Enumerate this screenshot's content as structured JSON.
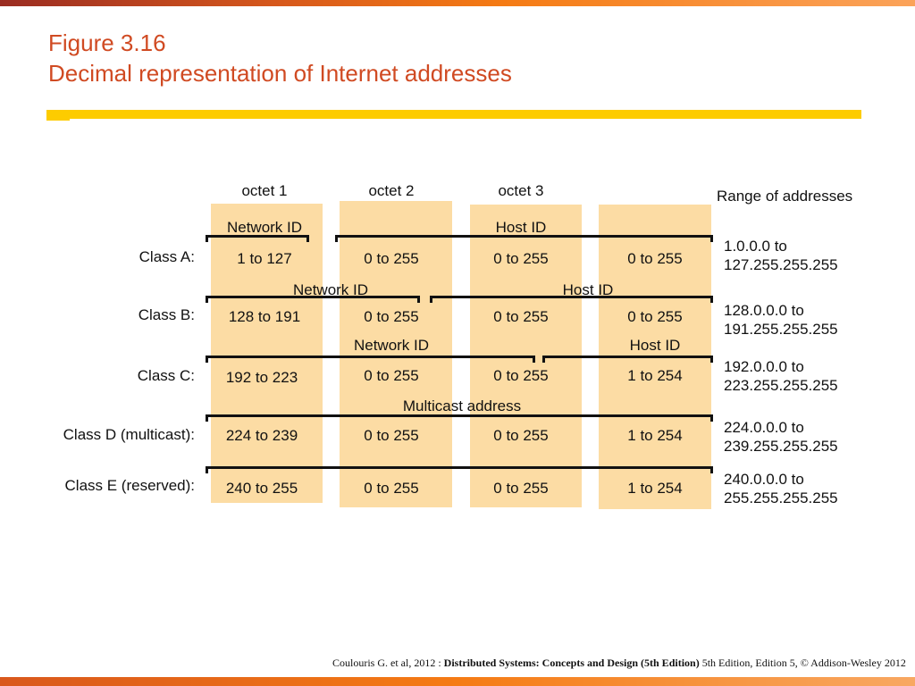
{
  "header": {
    "title_line1": "Figure 3.16",
    "title_line2": "Decimal representation of Internet addresses"
  },
  "columns": {
    "octet1": "octet 1",
    "octet2": "octet 2",
    "octet3": "octet 3",
    "range": "Range of addresses"
  },
  "rows": [
    {
      "label": "Class A:",
      "cells": [
        "1 to 127",
        "0 to 255",
        "0 to 255",
        "0 to 255"
      ],
      "range1": "1.0.0.0 to",
      "range2": "127.255.255.255",
      "net": "Network ID",
      "host": "Host ID"
    },
    {
      "label": "Class B:",
      "cells": [
        "128 to 191",
        "0 to 255",
        "0 to 255",
        "0 to 255"
      ],
      "range1": "128.0.0.0 to",
      "range2": "191.255.255.255",
      "net": "Network ID",
      "host": "Host ID"
    },
    {
      "label": "Class C:",
      "cells": [
        "192 to 223",
        "0 to 255",
        "0 to 255",
        "1 to 254"
      ],
      "range1": "192.0.0.0 to",
      "range2": "223.255.255.255",
      "net": "Network ID",
      "host": "Host ID"
    },
    {
      "label": "Class D (multicast):",
      "cells": [
        "224 to 239",
        "0 to 255",
        "0 to 255",
        "1 to 254"
      ],
      "range1": "224.0.0.0 to",
      "range2": "239.255.255.255",
      "net": "Multicast address"
    },
    {
      "label": "Class E (reserved):",
      "cells": [
        "240 to 255",
        "0 to 255",
        "0 to 255",
        "1 to 254"
      ],
      "range1": "240.0.0.0 to",
      "range2": "255.255.255.255"
    }
  ],
  "footer": {
    "pre": "Coulouris G. et al, 2012 : ",
    "bold": "Distributed Systems: Concepts and Design (5th Edition)",
    "post": " 5th Edition, Edition 5, © Addison-Wesley 2012"
  },
  "colors": {
    "title": "#d04a22",
    "accent_bar": "#fdcc00",
    "column_fill": "#fcdca4"
  }
}
